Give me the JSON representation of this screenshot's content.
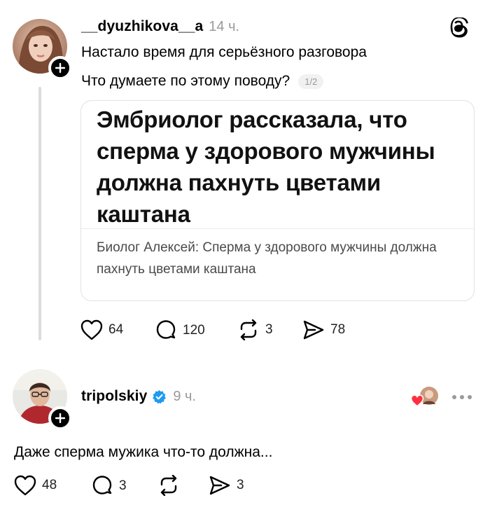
{
  "post1": {
    "username": "__dyuzhikova__a",
    "time": "14 ч.",
    "line1": "Настало время для серьёзного разговора",
    "line2": "Что думаете по этому поводу?",
    "pager": "1/2",
    "card": {
      "title": "Эмбриолог рассказала, что сперма у здорового мужчины должна пахнуть цветами каштана",
      "subtitle": "Биолог Алексей: Сперма у здорового мужчины должна пахнуть цветами каштана"
    },
    "actions": {
      "likes": "64",
      "comments": "120",
      "reposts": "3",
      "shares": "78"
    }
  },
  "post2": {
    "username": "tripolskiy",
    "time": "9 ч.",
    "text": "Даже сперма мужика что-то должна...",
    "actions": {
      "likes": "48",
      "comments": "3",
      "shares": "3"
    }
  },
  "colors": {
    "verified": "#1d9bf0",
    "heart_red": "#ff3040",
    "muted": "#9a9a9a"
  }
}
